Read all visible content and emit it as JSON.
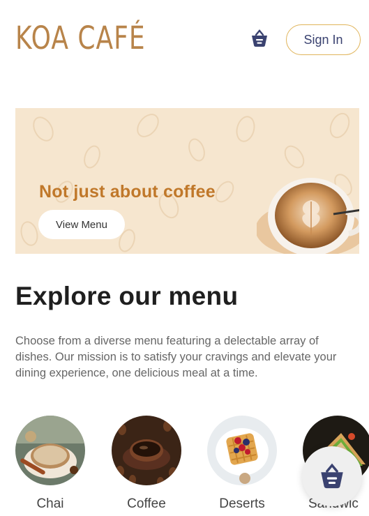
{
  "header": {
    "logo_text": "KOA CAFÉ",
    "cart_icon": "basket-icon",
    "signin_label": "Sign In"
  },
  "hero": {
    "title": "Not just about coffee",
    "button_label": "View Menu"
  },
  "explore": {
    "title": "Explore our menu",
    "description": "Choose from a diverse menu featuring a delectable array of dishes. Our mission is to satisfy your cravings and elevate your dining experience, one delicious meal at a time."
  },
  "categories": [
    {
      "label": "Chai"
    },
    {
      "label": "Coffee"
    },
    {
      "label": "Deserts"
    },
    {
      "label": "Sandwic"
    }
  ],
  "floating_cart": {
    "icon": "basket-icon"
  },
  "colors": {
    "brand": "#b8844a",
    "accent": "#c0782a",
    "navy": "#3a4270",
    "signin_border": "#e0b45a",
    "hero_bg": "#f6e6cf"
  }
}
